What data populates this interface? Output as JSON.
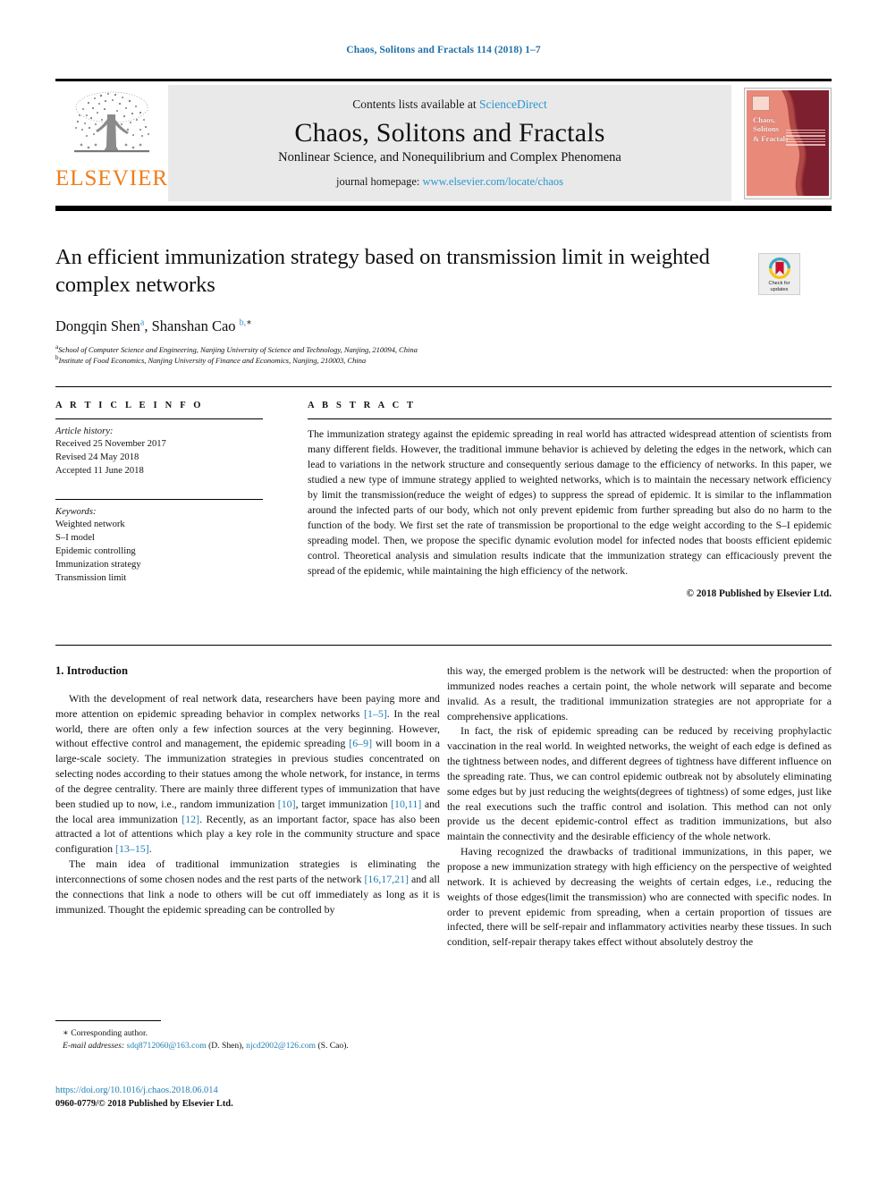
{
  "running_head": "Chaos, Solitons and Fractals 114 (2018) 1–7",
  "masthead": {
    "publisher_word": "ELSEVIER",
    "contents_prefix": "Contents lists available at ",
    "contents_link": "ScienceDirect",
    "journal_title": "Chaos, Solitons and Fractals",
    "journal_subtitle": "Nonlinear Science, and Nonequilibrium and Complex Phenomena",
    "homepage_prefix": "journal homepage: ",
    "homepage_url": "www.elsevier.com/locate/chaos",
    "cover_title": "Chaos,\nSolitons\n& Fractals"
  },
  "article": {
    "title": "An efficient immunization strategy based on transmission limit in weighted complex networks",
    "authors_html": "Dongqin Shen<sup>a</sup>, Shanshan Cao <sup>b,</sup><sup class=\"plain\">∗</sup>",
    "affiliation_a_marker": "a",
    "affiliation_a": "School of Computer Science and Engineering, Nanjing University of Science and Technology, Nanjing, 210094, China",
    "affiliation_b_marker": "b",
    "affiliation_b": "Institute of Food Economics, Nanjing University of Finance and Economics, Nanjing, 210003, China"
  },
  "crossmark": {
    "label_line1": "Check for",
    "label_line2": "updates",
    "ring_top_color": "#3aa9c4",
    "ring_bottom_color": "#f5c518",
    "ribbon_color": "#c8102e"
  },
  "article_info": {
    "heading": "A R T I C L E  I N F O",
    "history_label": "Article history:",
    "history": [
      "Received 25 November 2017",
      "Revised 24 May 2018",
      "Accepted 11 June 2018"
    ],
    "keywords_label": "Keywords:",
    "keywords": [
      "Weighted network",
      "S–I model",
      "Epidemic controlling",
      "Immunization strategy",
      "Transmission limit"
    ]
  },
  "abstract": {
    "heading": "A B S T R A C T",
    "text": "The immunization strategy against the epidemic spreading in real world has attracted widespread attention of scientists from many different fields. However, the traditional immune behavior is achieved by deleting the edges in the network, which can lead to variations in the network structure and consequently serious damage to the efficiency of networks. In this paper, we studied a new type of immune strategy applied to weighted networks, which is to maintain the necessary network efficiency by limit the transmission(reduce the weight of edges) to suppress the spread of epidemic. It is similar to the inflammation around the infected parts of our body, which not only prevent epidemic from further spreading but also do no harm to the function of the body. We first set the rate of transmission be proportional to the edge weight according to the S–I epidemic spreading model. Then, we propose the specific dynamic evolution model for infected nodes that boosts efficient epidemic control. Theoretical analysis and simulation results indicate that the immunization strategy can efficaciously prevent the spread of the epidemic, while maintaining the high efficiency of the network.",
    "copyright": "© 2018 Published by Elsevier Ltd."
  },
  "body": {
    "section_title": "1. Introduction",
    "left_paragraphs": [
      {
        "parts": [
          {
            "t": "With the development of real network data, researchers have been paying more and more attention on epidemic spreading behavior in complex networks "
          },
          {
            "t": "[1–5]",
            "ref": true
          },
          {
            "t": ". In the real world, there are often only a few infection sources at the very beginning. However, without effective control and management, the epidemic spreading "
          },
          {
            "t": "[6–9]",
            "ref": true
          },
          {
            "t": " will boom in a large-scale society. The immunization strategies in previous studies concentrated on selecting nodes according to their statues among the whole network, for instance, in terms of the degree centrality. There are mainly three different types of immunization that have been studied up to now, i.e., random immunization "
          },
          {
            "t": "[10]",
            "ref": true
          },
          {
            "t": ", target immunization "
          },
          {
            "t": "[10,11]",
            "ref": true
          },
          {
            "t": " and the local area immunization "
          },
          {
            "t": "[12]",
            "ref": true
          },
          {
            "t": ". Recently, as an important factor, space has also been attracted a lot of attentions which play a key role in the community structure and space configuration "
          },
          {
            "t": "[13–15]",
            "ref": true
          },
          {
            "t": "."
          }
        ]
      },
      {
        "parts": [
          {
            "t": "The main idea of traditional immunization strategies is eliminating the interconnections of some chosen nodes and the rest parts of the network "
          },
          {
            "t": "[16,17,21]",
            "ref": true
          },
          {
            "t": " and all the connections that link a node to others will be cut off immediately as long as it is immunized. Thought the epidemic spreading can be controlled by"
          }
        ]
      }
    ],
    "right_paragraphs": [
      {
        "parts": [
          {
            "t": "this way, the emerged problem is the network will be destructed: when the proportion of immunized nodes reaches a certain point, the whole network will separate and become invalid. As a result, the traditional immunization strategies are not appropriate for a comprehensive applications.",
            "noindent": true
          }
        ],
        "noindent": true
      },
      {
        "parts": [
          {
            "t": "In fact, the risk of epidemic spreading can be reduced by receiving prophylactic vaccination in the real world. In weighted networks, the weight of each edge is defined as the tightness between nodes, and different degrees of tightness have different influence on the spreading rate. Thus, we can control epidemic outbreak not by absolutely eliminating some edges but by just reducing the weights(degrees of tightness) of some edges, just like the real executions such the traffic control and isolation. This method can not only provide us the decent epidemic-control effect as tradition immunizations, but also maintain the connectivity and the desirable efficiency of the whole network."
          }
        ]
      },
      {
        "parts": [
          {
            "t": "Having recognized the drawbacks of traditional immunizations, in this paper, we propose a new immunization strategy with high efficiency on the perspective of weighted network. It is achieved by decreasing the weights of certain edges, i.e., reducing the weights of those edges(limit the transmission) who are connected with specific nodes. In order to prevent epidemic from spreading, when a certain proportion of tissues are infected, there will be self-repair and inflammatory activities nearby these tissues. In such condition, self-repair therapy takes effect without absolutely destroy the"
          }
        ]
      }
    ]
  },
  "footnote": {
    "corresponding_star": "∗",
    "corresponding_label": "Corresponding author.",
    "email_label": "E-mail addresses:",
    "email_1": "sdq8712060@163.com",
    "email_1_person": "(D. Shen),",
    "email_2": "njcd2002@126.com",
    "email_2_person": "(S. Cao)."
  },
  "footer": {
    "doi": "https://doi.org/10.1016/j.chaos.2018.06.014",
    "issn": "0960-0779/© 2018 Published by Elsevier Ltd."
  }
}
